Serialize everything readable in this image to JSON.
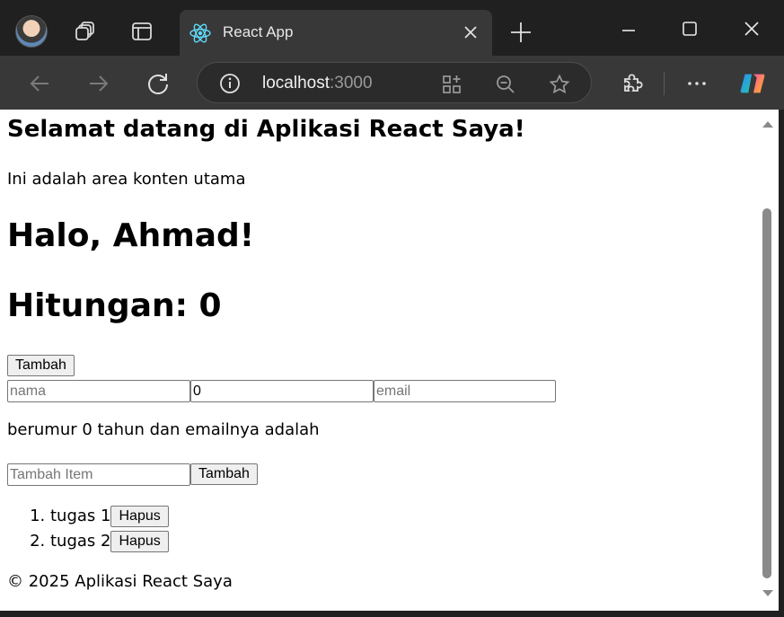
{
  "browser": {
    "tab_title": "React App",
    "url_host": "localhost",
    "url_port": ":3000"
  },
  "page": {
    "welcome": "Selamat datang di Aplikasi React Saya!",
    "intro": "Ini adalah area konten utama",
    "greeting": "Halo, Ahmad!",
    "counter": "Hitungan: 0",
    "add_button": "Tambah",
    "name_field": {
      "value": "",
      "placeholder": "nama"
    },
    "age_field": {
      "value": "0",
      "placeholder": ""
    },
    "email_field": {
      "value": "",
      "placeholder": "email"
    },
    "info": "berumur 0 tahun dan emailnya adalah",
    "item_input": {
      "value": "",
      "placeholder": "Tambah Item"
    },
    "item_add_button": "Tambah",
    "items": [
      {
        "label": "tugas 1",
        "delete": "Hapus"
      },
      {
        "label": "tugas 2",
        "delete": "Hapus"
      }
    ],
    "footer": "© 2025 Aplikasi React Saya"
  }
}
